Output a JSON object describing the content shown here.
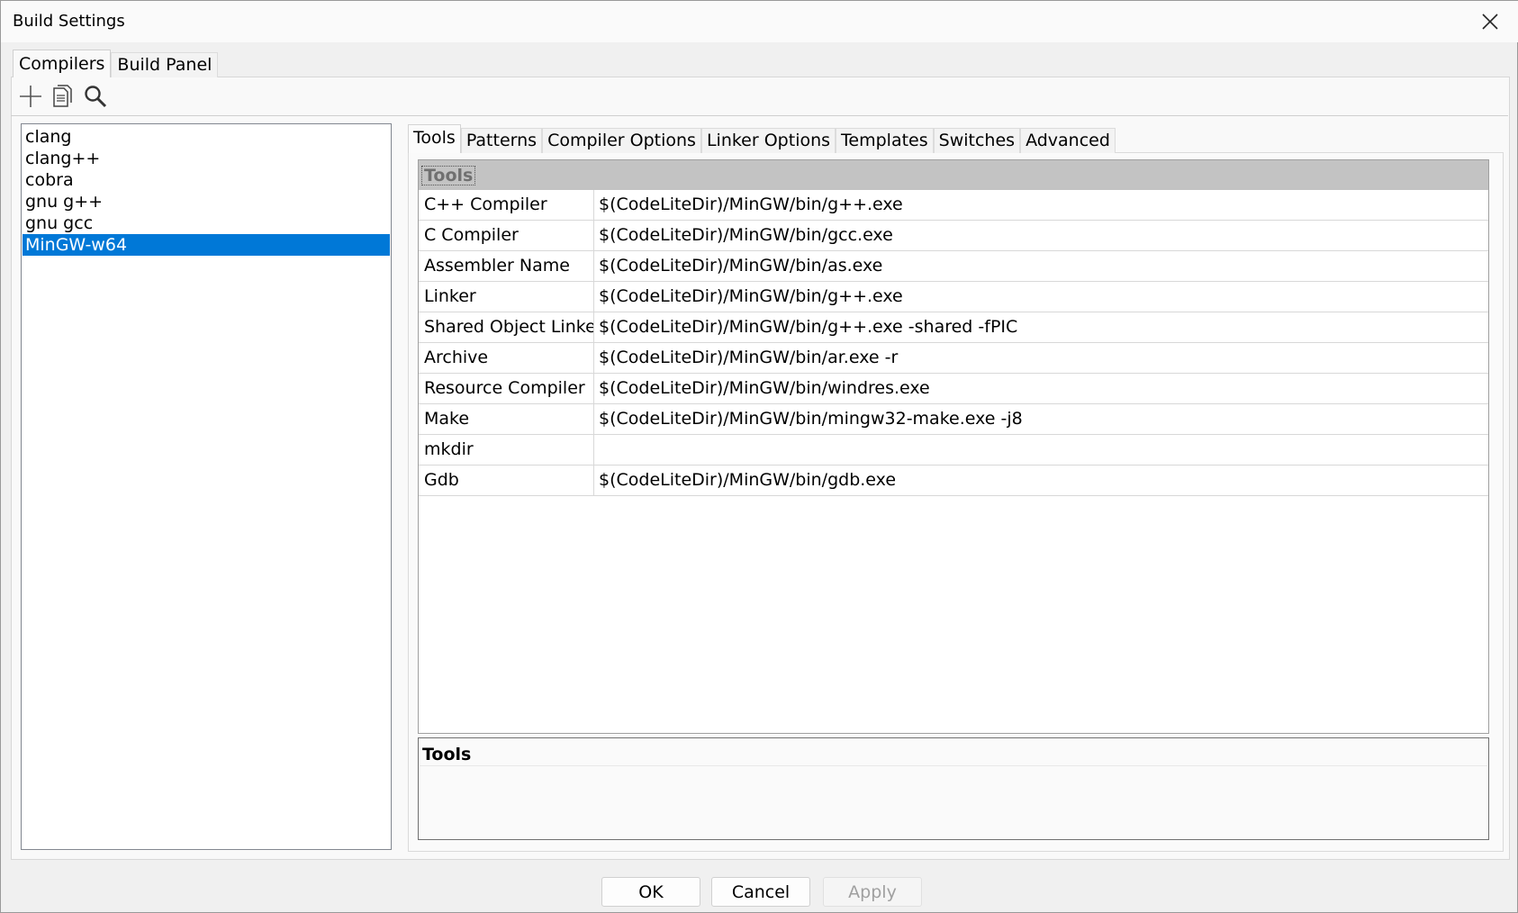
{
  "window": {
    "title": "Build Settings"
  },
  "top_tabs": [
    {
      "label": "Compilers",
      "active": true
    },
    {
      "label": "Build Panel",
      "active": false
    }
  ],
  "toolbar": {
    "items": [
      {
        "icon": "plus-icon"
      },
      {
        "icon": "copy-document-icon"
      },
      {
        "icon": "search-icon"
      }
    ]
  },
  "compilers": [
    "clang",
    "clang++",
    "cobra",
    "gnu g++",
    "gnu gcc",
    "MinGW-w64"
  ],
  "selected_compiler": "MinGW-w64",
  "inner_tabs": [
    "Tools",
    "Patterns",
    "Compiler Options",
    "Linker Options",
    "Templates",
    "Switches",
    "Advanced"
  ],
  "grid": {
    "category": "Tools",
    "rows": [
      {
        "name": "C++ Compiler",
        "value": "$(CodeLiteDir)/MinGW/bin/g++.exe"
      },
      {
        "name": "C Compiler",
        "value": "$(CodeLiteDir)/MinGW/bin/gcc.exe"
      },
      {
        "name": "Assembler Name",
        "value": "$(CodeLiteDir)/MinGW/bin/as.exe"
      },
      {
        "name": "Linker",
        "value": "$(CodeLiteDir)/MinGW/bin/g++.exe"
      },
      {
        "name": "Shared Object Linker",
        "value": "$(CodeLiteDir)/MinGW/bin/g++.exe -shared -fPIC"
      },
      {
        "name": "Archive",
        "value": "$(CodeLiteDir)/MinGW/bin/ar.exe -r"
      },
      {
        "name": "Resource Compiler",
        "value": "$(CodeLiteDir)/MinGW/bin/windres.exe"
      },
      {
        "name": "Make",
        "value": "$(CodeLiteDir)/MinGW/bin/mingw32-make.exe -j8"
      },
      {
        "name": "mkdir",
        "value": ""
      },
      {
        "name": "Gdb",
        "value": "$(CodeLiteDir)/MinGW/bin/gdb.exe"
      }
    ]
  },
  "description": {
    "title": "Tools"
  },
  "buttons": {
    "ok": "OK",
    "cancel": "Cancel",
    "apply": "Apply"
  },
  "colors": {
    "selection": "#0078d7",
    "category_bg": "#c3c3c3"
  }
}
